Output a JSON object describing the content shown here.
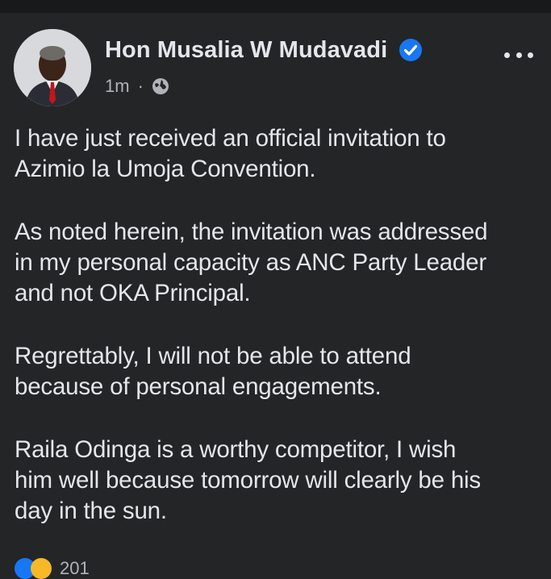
{
  "post": {
    "author": "Hon Musalia W Mudavadi",
    "timestamp": "1m",
    "separator": "·",
    "audience_icon": "globe-icon",
    "verified_icon": "verified-badge-icon",
    "more_icon": "more-options-icon",
    "paragraphs": [
      "I have just received an official invitation to\nAzimio la Umoja Convention.",
      "As noted herein, the invitation was addressed\nin my personal capacity as ANC Party Leader\nand not OKA Principal.",
      "Regrettably, I will not be able to attend\nbecause of personal engagements.",
      "Raila Odinga is a worthy competitor, I wish\nhim well because tomorrow will clearly be his\nday in the sun."
    ],
    "reactions": {
      "icons": [
        "like-icon",
        "haha-icon"
      ],
      "count": "201"
    }
  },
  "colors": {
    "background": "#242526",
    "text": "#e4e6eb",
    "secondary_text": "#b0b3b8",
    "verified": "#1877f2"
  }
}
